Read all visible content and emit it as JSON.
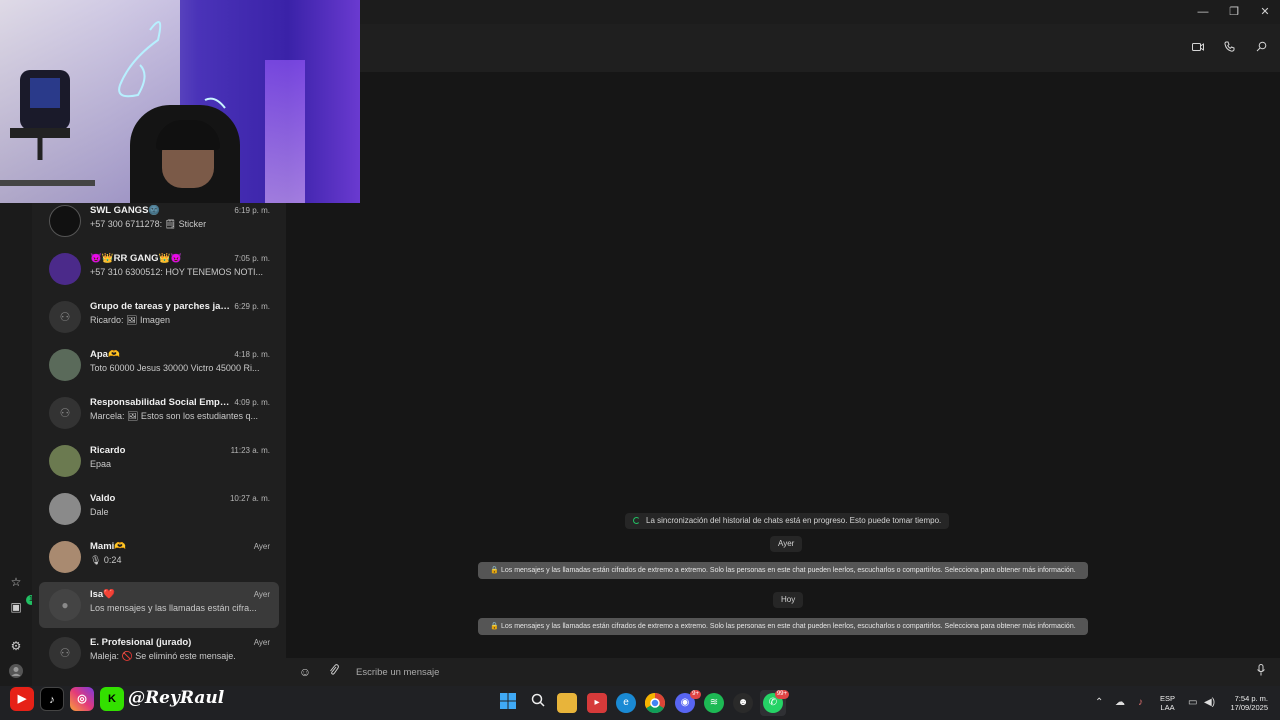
{
  "window": {
    "minimize": "—",
    "restore": "❐",
    "close": "✕"
  },
  "rail": {
    "community_badge": "1"
  },
  "chats": [
    {
      "name": "SWL GANGS🌚",
      "time": "6:19 p. m.",
      "preview": "+57 300 6711278: 🗒 Sticker",
      "avatar": "logo",
      "avatar_color": "#111111"
    },
    {
      "name": "😈👑RR GANG👑😈",
      "time": "7:05 p. m.",
      "preview": "+57 310 6300512: HOY TENEMOS NOTI...",
      "avatar": "photo",
      "avatar_color": "#4b2a8a"
    },
    {
      "name": "Grupo de tareas y parches jajaja",
      "time": "6:29 p. m.",
      "preview": "Ricardo: 🖼 Imagen",
      "avatar": "group",
      "avatar_color": "#333333"
    },
    {
      "name": "Apa🫶",
      "time": "4:18 p. m.",
      "preview": "Toto 60000 Jesus 30000 Victro 45000 Ri...",
      "avatar": "photo",
      "avatar_color": "#5a6a5a"
    },
    {
      "name": "Responsabilidad Social Empre...",
      "time": "4:09 p. m.",
      "preview": "Marcela: 🖼 Estos son los estudiantes q...",
      "avatar": "group",
      "avatar_color": "#333333"
    },
    {
      "name": "Ricardo",
      "time": "11:23 a. m.",
      "preview": "Epaa",
      "avatar": "photo",
      "avatar_color": "#6b7a50"
    },
    {
      "name": "Valdo",
      "time": "10:27 a. m.",
      "preview": "Dale",
      "avatar": "photo",
      "avatar_color": "#8a8a8a"
    },
    {
      "name": "Mami🫶",
      "time": "Ayer",
      "preview": "🎙 0:24",
      "avatar": "photo",
      "avatar_color": "#a98a70"
    },
    {
      "name": "Isa❤️",
      "time": "Ayer",
      "preview": "Los mensajes y las llamadas están cifra...",
      "avatar": "person",
      "avatar_color": "#444444"
    },
    {
      "name": "E. Profesional (jurado)",
      "time": "Ayer",
      "preview": "Maleja: 🚫 Se eliminó este mensaje.",
      "avatar": "group",
      "avatar_color": "#333333"
    }
  ],
  "conversation": {
    "sync_notice": "La sincronización del historial de chats está en progreso. Esto puede tomar tiempo.",
    "date_yesterday": "Ayer",
    "encryption_notice_1": "🔒 Los mensajes y las llamadas están cifrados de extremo a extremo. Solo las personas en este chat pueden leerlos, escucharlos o compartirlos. Selecciona para obtener más información.",
    "date_today": "Hoy",
    "encryption_notice_2": "🔒 Los mensajes y las llamadas están cifrados de extremo a extremo. Solo las personas en este chat pueden leerlos, escucharlos o compartirlos. Selecciona para obtener más información.",
    "input_placeholder": "Escribe un mensaje"
  },
  "taskbar": {
    "discord_badge": "9+",
    "whatsapp_badge": "99+",
    "lang_1": "ESP",
    "lang_2": "LAA",
    "time": "7:54 p. m.",
    "date": "17/09/2025"
  },
  "overlay": {
    "handle": "@ReyRaul"
  },
  "colors": {
    "accent": "#21c063",
    "background": "#161616",
    "panel": "#1f1f1f"
  }
}
